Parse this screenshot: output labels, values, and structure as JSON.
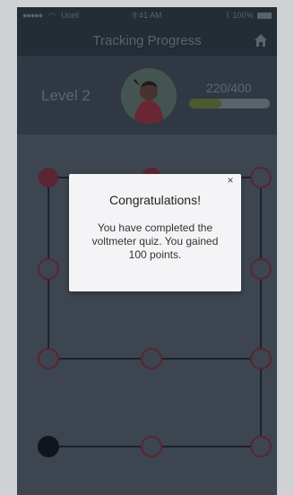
{
  "status_bar": {
    "carrier": "Ucell",
    "time": "9:41 AM",
    "battery": "100%"
  },
  "header": {
    "title": "Tracking Progress",
    "home_icon": "home-icon"
  },
  "level_panel": {
    "level": "Level 2",
    "score": "220/400",
    "progress": 0.4,
    "colors": {
      "progress_fill": "#4d5a2d",
      "track": "#5a626b"
    }
  },
  "path_map": {
    "node_completed_color": "#5a2530",
    "node_current_color": "#10151b",
    "node_open_color": "#5a2530"
  },
  "dialog": {
    "title": "Congratulations!",
    "message": "You have completed the voltmeter quiz. You gained 100 points.",
    "close": "×"
  }
}
